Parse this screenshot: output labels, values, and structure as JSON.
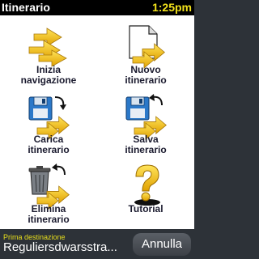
{
  "header": {
    "title": "Itinerario",
    "time": "1:25pm"
  },
  "menu": {
    "items": [
      {
        "label": "Inizia\nnavigazione",
        "icon": "start-navigation-arrows-icon"
      },
      {
        "label": "Nuovo\nitinerario",
        "icon": "new-document-arrows-icon"
      },
      {
        "label": "Carica\nitinerario",
        "icon": "load-floppy-arrows-icon"
      },
      {
        "label": "Salva\nitinerario",
        "icon": "save-floppy-arrows-icon"
      },
      {
        "label": "Elimina\nitinerario",
        "icon": "trash-arrows-icon"
      },
      {
        "label": "Tutorial",
        "icon": "question-mark-icon"
      }
    ]
  },
  "footer": {
    "destination_caption": "Prima destinazione",
    "destination_value": "Reguliersdwarsstra...",
    "cancel_label": "Annulla"
  },
  "colors": {
    "accent_yellow": "#f2e21b",
    "arrow_yellow": "#f2c51c",
    "dark_bar": "#2d3238",
    "header_bg": "#000000"
  }
}
